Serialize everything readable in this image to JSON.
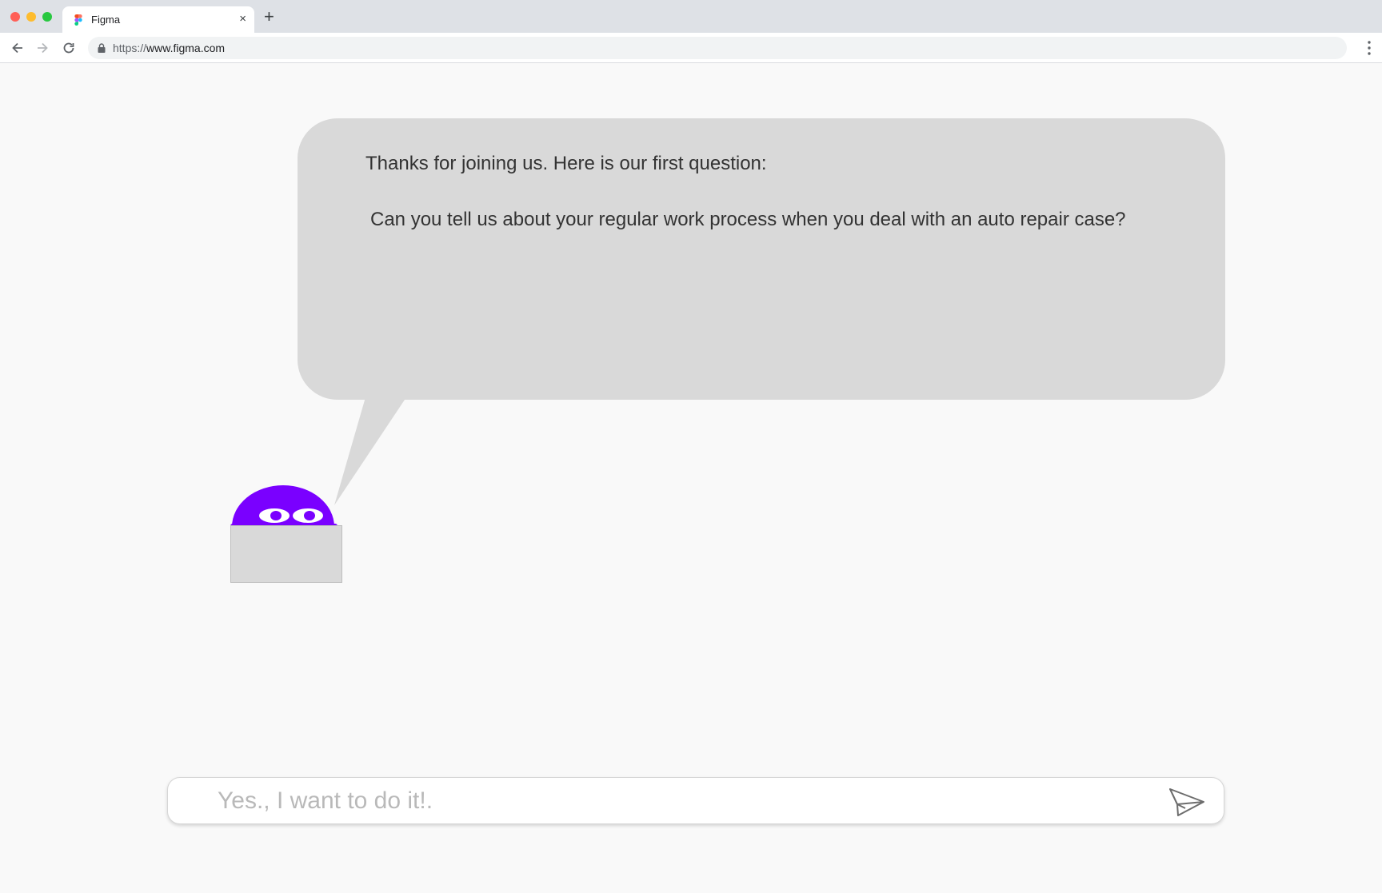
{
  "browser": {
    "tab_title": "Figma",
    "tab_close": "×",
    "new_tab": "+",
    "url_scheme": "https://",
    "url_host": "www.figma.com",
    "icons": {
      "favicon": "figma-logo-icon",
      "back": "arrow-left-icon",
      "forward": "arrow-right-icon",
      "reload": "reload-icon",
      "lock": "lock-icon",
      "menu": "kebab-menu-icon"
    }
  },
  "chat": {
    "intro": "Thanks for joining us. Here is our first question:",
    "question": "Can you tell us about your regular work process when you deal with an auto repair case?",
    "input_placeholder": "Yes., I want to do it!.",
    "send_icon": "paper-plane-icon",
    "avatar_icon": "purple-bot-avatar-icon"
  },
  "colors": {
    "bubble": "#d9d9d9",
    "avatar": "#7a00ff",
    "page_bg": "#f9f9f9"
  }
}
